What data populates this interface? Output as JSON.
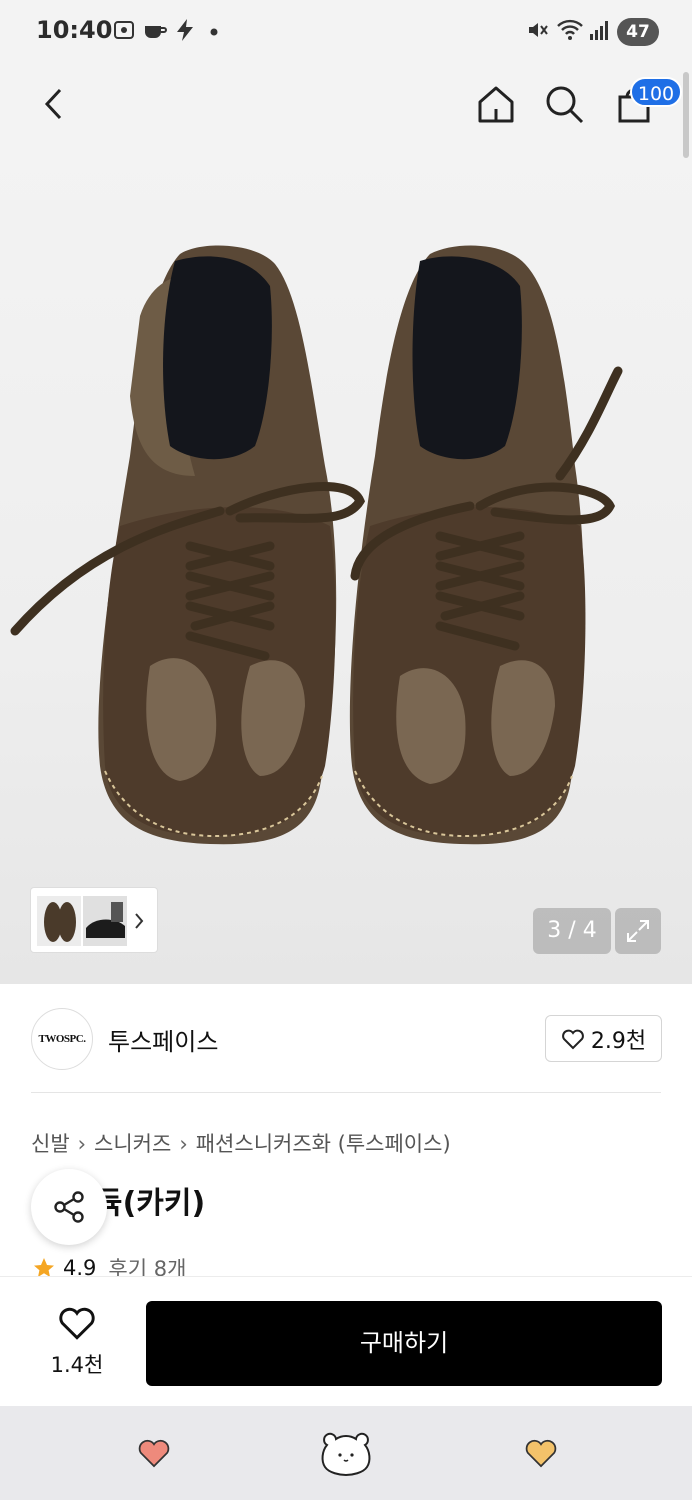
{
  "status_bar": {
    "time": "10:40",
    "battery": "47"
  },
  "header": {
    "back": "back",
    "icons": [
      "home-icon",
      "search-icon",
      "cart-icon"
    ],
    "cart_badge": "100"
  },
  "gallery": {
    "counter": "3 / 4"
  },
  "brand": {
    "logo_text": "TWOSPC.",
    "name": "투스페이스",
    "likes": "2.9천"
  },
  "breadcrumb": [
    "신발",
    "스니커즈",
    "패션스니커즈화 (투스페이스)"
  ],
  "product": {
    "title_visible": "듁(카키)",
    "rating": "4.9",
    "reviews": "후기 8개"
  },
  "action_bar": {
    "wish_count": "1.4천",
    "buy_label": "구매하기"
  },
  "colors": {
    "accent_blue": "#1f6fe6",
    "buy_bg": "#000000",
    "star": "#f5a623"
  }
}
